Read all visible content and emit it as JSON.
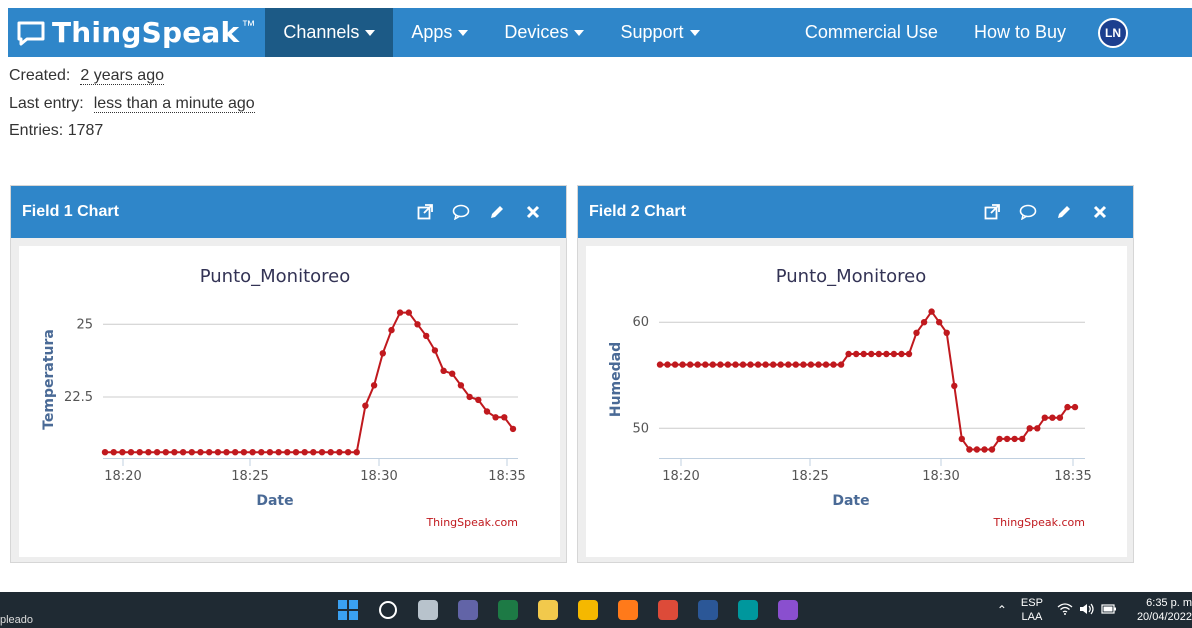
{
  "navbar": {
    "brand": "ThingSpeak",
    "brand_tm": "™",
    "items": [
      {
        "label": "Channels",
        "caret": true,
        "active": true
      },
      {
        "label": "Apps",
        "caret": true,
        "active": false
      },
      {
        "label": "Devices",
        "caret": true,
        "active": false
      },
      {
        "label": "Support",
        "caret": true,
        "active": false
      }
    ],
    "right_items": [
      "Commercial Use",
      "How to Buy"
    ],
    "avatar_initials": "LN"
  },
  "channel_info": {
    "created_label": "Created:",
    "created_value": "2 years ago",
    "last_entry_label": "Last entry:",
    "last_entry_value": "less than a minute ago",
    "entries_label": "Entries:",
    "entries_value": "1787"
  },
  "panels": [
    {
      "title": "Field 1 Chart",
      "icons": [
        "external-link-icon",
        "comment-icon",
        "pencil-icon",
        "close-icon"
      ]
    },
    {
      "title": "Field 2 Chart",
      "icons": [
        "external-link-icon",
        "comment-icon",
        "pencil-icon",
        "close-icon"
      ]
    }
  ],
  "chart_data": [
    {
      "type": "line",
      "title": "Punto_Monitoreo",
      "xlabel": "Date",
      "ylabel": "Temperatura",
      "credit": "ThingSpeak.com",
      "xlim": [
        18.33,
        18.592
      ],
      "ylim": [
        20.4,
        25.8
      ],
      "x_ticks": [
        "18:20",
        "18:25",
        "18:30",
        "18:35"
      ],
      "y_ticks": [
        22.5,
        25
      ],
      "y_tick_labels": [
        "22.5",
        "25"
      ],
      "color": "#c0191e",
      "x": [
        "18:20",
        "18:20",
        "18:21",
        "18:21",
        "18:21",
        "18:21",
        "18:22",
        "18:22",
        "18:22",
        "18:23",
        "18:23",
        "18:23",
        "18:24",
        "18:24",
        "18:24",
        "18:25",
        "18:25",
        "18:25",
        "18:26",
        "18:26",
        "18:26",
        "18:27",
        "18:27",
        "18:27",
        "18:28",
        "18:28",
        "18:28",
        "18:29",
        "18:29",
        "18:29",
        "18:30",
        "18:30",
        "18:30",
        "18:30",
        "18:31",
        "18:31",
        "18:31",
        "18:32",
        "18:32",
        "18:32",
        "18:33",
        "18:33",
        "18:33",
        "18:34",
        "18:34",
        "18:34",
        "18:35",
        "18:35"
      ],
      "y": [
        20.6,
        20.6,
        20.6,
        20.6,
        20.6,
        20.6,
        20.6,
        20.6,
        20.6,
        20.6,
        20.6,
        20.6,
        20.6,
        20.6,
        20.6,
        20.6,
        20.6,
        20.6,
        20.6,
        20.6,
        20.6,
        20.6,
        20.6,
        20.6,
        20.6,
        20.6,
        20.6,
        20.6,
        20.6,
        20.6,
        22.2,
        22.9,
        24.0,
        24.8,
        25.4,
        25.4,
        25.0,
        24.6,
        24.1,
        23.4,
        23.3,
        22.9,
        22.5,
        22.4,
        22.0,
        21.8,
        21.8,
        21.4
      ]
    },
    {
      "type": "line",
      "title": "Punto_Monitoreo",
      "xlabel": "Date",
      "ylabel": "Humedad",
      "credit": "ThingSpeak.com",
      "xlim": [
        18.33,
        18.592
      ],
      "ylim": [
        47.2,
        62
      ],
      "x_ticks": [
        "18:20",
        "18:25",
        "18:30",
        "18:35"
      ],
      "y_ticks": [
        50,
        60
      ],
      "y_tick_labels": [
        "50",
        "60"
      ],
      "color": "#c0191e",
      "x": [
        "18:20",
        "18:20",
        "18:21",
        "18:21",
        "18:21",
        "18:21",
        "18:22",
        "18:22",
        "18:22",
        "18:23",
        "18:23",
        "18:23",
        "18:24",
        "18:24",
        "18:24",
        "18:25",
        "18:25",
        "18:25",
        "18:26",
        "18:26",
        "18:26",
        "18:27",
        "18:27",
        "18:27",
        "18:28",
        "18:28",
        "18:28",
        "18:29",
        "18:29",
        "18:29",
        "18:30",
        "18:30",
        "18:30",
        "18:30",
        "18:31",
        "18:31",
        "18:31",
        "18:32",
        "18:32",
        "18:32",
        "18:33",
        "18:33",
        "18:33",
        "18:34",
        "18:34",
        "18:34",
        "18:35",
        "18:35"
      ],
      "y": [
        56,
        56,
        56,
        56,
        56,
        56,
        56,
        56,
        56,
        56,
        56,
        56,
        56,
        56,
        56,
        56,
        56,
        56,
        56,
        56,
        56,
        56,
        56,
        56,
        56,
        57,
        57,
        57,
        57,
        57,
        57,
        57,
        57,
        57,
        59,
        60,
        61,
        60,
        59,
        54,
        49,
        48,
        48,
        48,
        48,
        49,
        49,
        49,
        49,
        50,
        50,
        51,
        51,
        51,
        52,
        52
      ]
    }
  ],
  "taskbar": {
    "left_text": "pleado",
    "language": "ESP",
    "language_sub": "LAA",
    "time": "6:35 p. m",
    "date": "20/04/2022",
    "apps": [
      {
        "name": "windows-start-icon",
        "color": "#3aa0f0"
      },
      {
        "name": "search-icon",
        "color": "#ffffff"
      },
      {
        "name": "task-view-icon",
        "color": "#b8c3cc"
      },
      {
        "name": "teams-icon",
        "color": "#6264a7"
      },
      {
        "name": "excel-icon",
        "color": "#1d7a45"
      },
      {
        "name": "sticky-notes-icon",
        "color": "#f2c94c"
      },
      {
        "name": "file-explorer-icon",
        "color": "#f5b800"
      },
      {
        "name": "firefox-icon",
        "color": "#ff7a1a"
      },
      {
        "name": "chrome-icon",
        "color": "#dd4b39"
      },
      {
        "name": "word-icon",
        "color": "#2b5797"
      },
      {
        "name": "arduino-icon",
        "color": "#00979d"
      },
      {
        "name": "mqtt-icon",
        "color": "#8a4fcf"
      }
    ]
  }
}
